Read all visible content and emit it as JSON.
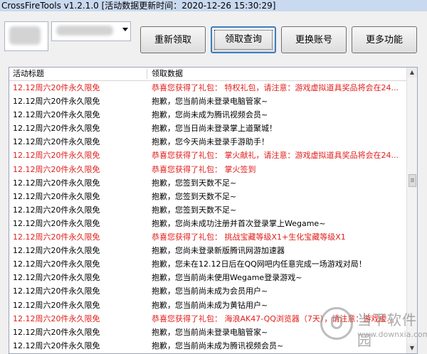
{
  "window": {
    "title": "CrossFireTools v1.2.1.0 [活动数据更新时间：2020-12-26 15:30:29]"
  },
  "toolbar": {
    "buttons": [
      {
        "label": "重新领取"
      },
      {
        "label": "领取查询"
      },
      {
        "label": "更换账号"
      },
      {
        "label": "更多功能"
      }
    ],
    "active_button": "领取查询"
  },
  "list": {
    "columns": [
      "活动标题",
      "领取数据"
    ],
    "rows": [
      {
        "title": "12.12周六20件永久限免",
        "data": "恭喜您获得了礼包：  特权礼包，请注意：游戏虚拟道具奖品将会在24...",
        "highlight": true
      },
      {
        "title": "12.12周六20件永久限免",
        "data": "抱歉，您当前尚未登录电脑管家~",
        "highlight": false
      },
      {
        "title": "12.12周六20件永久限免",
        "data": "抱歉，您尚未成为腾讯视频会员~",
        "highlight": false
      },
      {
        "title": "12.12周六20件永久限免",
        "data": "抱歉，您当日尚未登录掌上道聚城！",
        "highlight": false
      },
      {
        "title": "12.12周六20件永久限免",
        "data": "抱歉，您今天尚未登录手游助手！",
        "highlight": false
      },
      {
        "title": "12.12周六20件永久限免",
        "data": "恭喜您获得了礼包：  掌火献礼，请注意：游戏虚拟道具奖品将会在24...",
        "highlight": true
      },
      {
        "title": "12.12周六20件永久限免",
        "data": "恭喜您获得了礼包：  掌火签到",
        "highlight": true
      },
      {
        "title": "12.12周六20件永久限免",
        "data": "抱歉，您签到天数不足~",
        "highlight": false
      },
      {
        "title": "12.12周六20件永久限免",
        "data": "抱歉，您签到天数不足~",
        "highlight": false
      },
      {
        "title": "12.12周六20件永久限免",
        "data": "抱歉，您签到天数不足~",
        "highlight": false
      },
      {
        "title": "12.12周六20件永久限免",
        "data": "抱歉，您尚未成功注册并首次登录掌上Wegame~",
        "highlight": false
      },
      {
        "title": "12.12周六20件永久限免",
        "data": "恭喜您获得了礼包：  挑战宝藏等级X1+生化宝藏等级X1",
        "highlight": true
      },
      {
        "title": "12.12周六20件永久限免",
        "data": "抱歉，您尚未登录新版腾讯网游加速器",
        "highlight": false
      },
      {
        "title": "12.12周六20件永久限免",
        "data": "抱歉，您未在12.12日后在QQ网吧内任意完成一场游戏对局！",
        "highlight": false
      },
      {
        "title": "12.12周六20件永久限免",
        "data": "抱歉，您当前尚未使用Wegame登录游戏~",
        "highlight": false
      },
      {
        "title": "12.12周六20件永久限免",
        "data": "抱歉，您当前尚未成为会员用户~",
        "highlight": false
      },
      {
        "title": "12.12周六20件永久限免",
        "data": "抱歉，您当前尚未成为黄钻用户~",
        "highlight": false
      },
      {
        "title": "12.12周六20件永久限免",
        "data": "恭喜您获得了礼包：  海浪AK47-QQ浏览器（7天），请注意：游戏虚...",
        "highlight": true
      },
      {
        "title": "12.12周六20件永久限免",
        "data": "抱歉，您当前尚未登录电脑管家~",
        "highlight": false
      },
      {
        "title": "12.12周六20件永久限免",
        "data": "抱歉，您当前尚未成为腾讯视频会员~",
        "highlight": false
      }
    ]
  },
  "colors": {
    "highlight_text": "#e0201c",
    "normal_text": "#000000",
    "accent": "#3d7bc5"
  },
  "watermark": {
    "brand": "当下软件园",
    "url": "www.downxia.com"
  }
}
